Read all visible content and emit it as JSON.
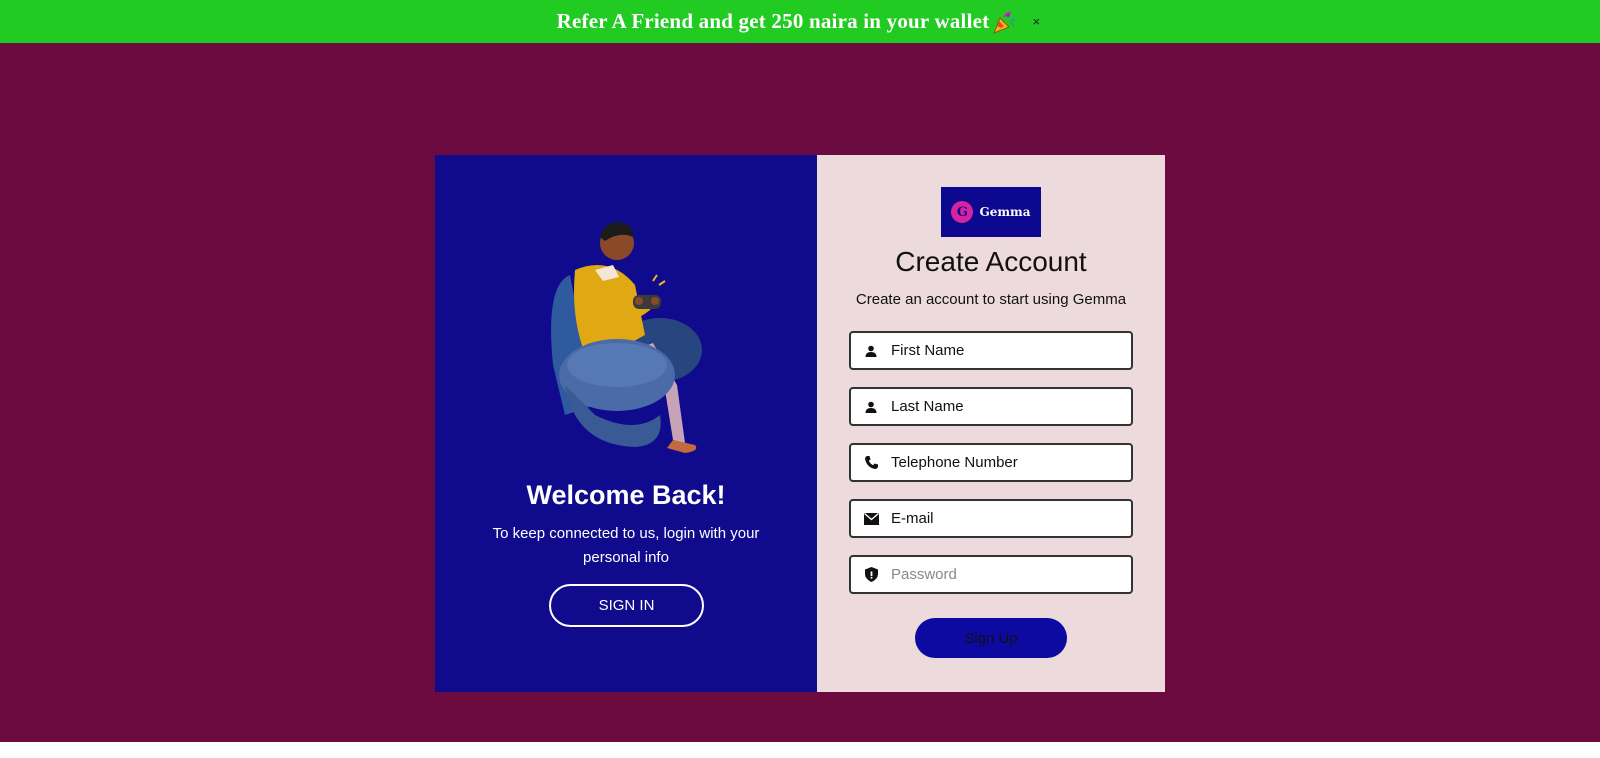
{
  "banner": {
    "text": "Refer A Friend and get 250 naira in your wallet",
    "icon": "party-popper-icon",
    "close_label": "×"
  },
  "welcome": {
    "title": "Welcome Back!",
    "subtitle": "To keep connected to us, login with your personal info",
    "signin_label": "SIGN IN"
  },
  "logo": {
    "mark": "G",
    "text": "Gemma"
  },
  "form": {
    "title": "Create Account",
    "subtitle": "Create an account to start using Gemma",
    "fields": [
      {
        "value": "First Name",
        "placeholder": "",
        "icon": "user-icon"
      },
      {
        "value": "Last Name",
        "placeholder": "",
        "icon": "user-icon"
      },
      {
        "value": "Telephone Number",
        "placeholder": "",
        "icon": "phone-icon"
      },
      {
        "value": "E-mail",
        "placeholder": "",
        "icon": "mail-icon"
      },
      {
        "value": "",
        "placeholder": "Password",
        "icon": "shield-icon"
      }
    ],
    "signup_label": "Sign Up"
  },
  "colors": {
    "background": "#6c0b40",
    "banner": "#22cb22",
    "left_panel": "#100b8c",
    "right_panel": "#ecdadc",
    "button": "#0c0aa0"
  }
}
